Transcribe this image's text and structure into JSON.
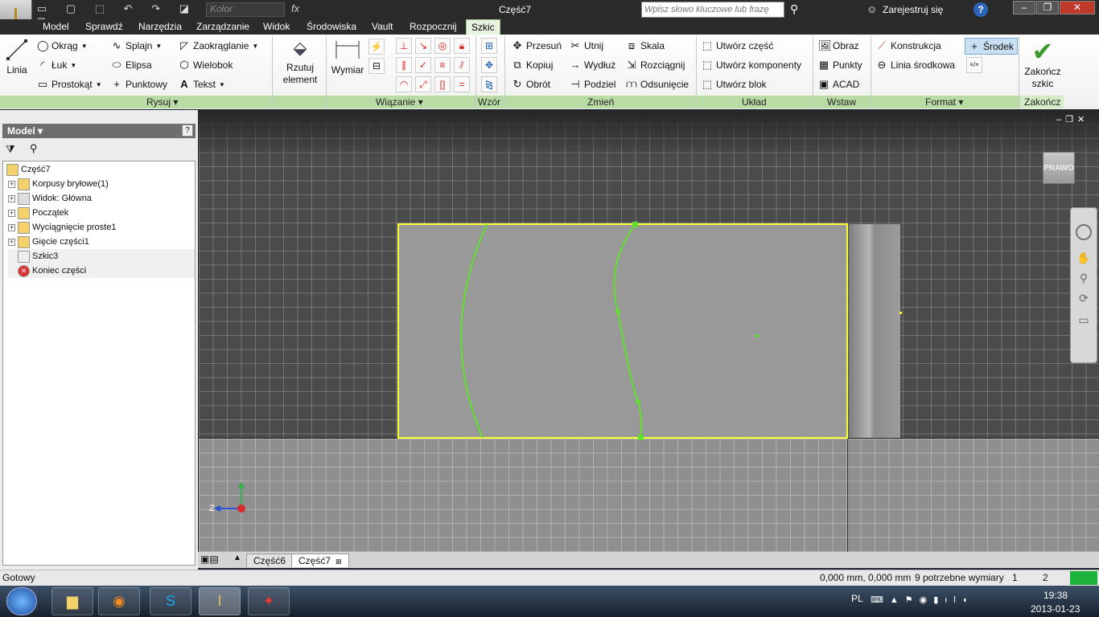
{
  "window": {
    "title": "Część7"
  },
  "quick_access": {
    "color_placeholder": "Kolor",
    "fx": "fx"
  },
  "search": {
    "placeholder": "Wpisz słowo kluczowe lub frazę",
    "signin": "Zarejestruj się",
    "help": "?"
  },
  "menu": {
    "items": [
      "Model",
      "Sprawdź",
      "Narzędzia",
      "Zarządzanie",
      "Widok",
      "Środowiska",
      "Vault",
      "Rozpocznij",
      "Szkic"
    ],
    "active": "Szkic"
  },
  "ribbon": {
    "draw": {
      "line": "Linia",
      "circle": "Okrąg",
      "arc": "Łuk",
      "rectangle": "Prostokąt",
      "spline": "Splajn",
      "ellipse": "Elipsa",
      "point": "Punktowy",
      "fillet": "Zaokrąglanie",
      "polygon": "Wielobok",
      "text": "Tekst",
      "project": "Rzutuj element"
    },
    "constrain": {
      "dimension": "Wymiar"
    },
    "modify": {
      "move": "Przesuń",
      "copy": "Kopiuj",
      "rotate": "Obrót",
      "trim": "Utnij",
      "extend": "Wydłuż",
      "split": "Podziel",
      "scale": "Skala",
      "stretch": "Rozciągnij",
      "offset": "Odsunięcie"
    },
    "layout": {
      "make_part": "Utwórz część",
      "make_components": "Utwórz komponenty",
      "create_block": "Utwórz blok"
    },
    "insert": {
      "image": "Obraz",
      "points": "Punkty",
      "acad": "ACAD"
    },
    "format": {
      "construction": "Konstrukcja",
      "centerline": "Linia środkowa",
      "center_point": "Środek"
    },
    "finish": {
      "finish_sketch": "Zakończ szkic"
    },
    "groups": {
      "draw": "Rysuj",
      "constrain": "Wiązanie",
      "pattern": "Wzór",
      "modify": "Zmień",
      "layout": "Układ",
      "insert": "Wstaw",
      "format": "Format",
      "exit": "Zakończ"
    }
  },
  "browser": {
    "title": "Model",
    "tree": [
      "Część7",
      "Korpusy bryłowe(1)",
      "Widok: Główna",
      "Początek",
      "Wyciągnięcie proste1",
      "Gięcie części1",
      "Szkic3",
      "Koniec części"
    ]
  },
  "viewcube": {
    "face": "PRAWO"
  },
  "axes": {
    "z": "Z"
  },
  "doc_tabs": [
    "Część6",
    "Część7"
  ],
  "status": {
    "left": "Gotowy",
    "coords": "0,000 mm, 0,000 mm",
    "dims": "9 potrzebne wymiary",
    "n1": "1",
    "n2": "2"
  },
  "taskbar": {
    "lang": "PL",
    "time": "19:38",
    "date": "2013-01-23"
  },
  "colors": {
    "accent": "#7dc142",
    "sketch_green": "#5fe02c",
    "sketch_yellow": "#ffff2e"
  }
}
